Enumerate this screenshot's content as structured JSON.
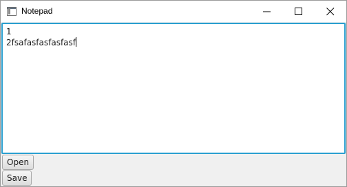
{
  "window": {
    "title": "Notepad",
    "icon": "notepad-app-icon"
  },
  "controls": {
    "minimize_icon": "minimize-icon",
    "maximize_icon": "maximize-icon",
    "close_icon": "close-icon"
  },
  "editor": {
    "lines": [
      "1",
      "2fsafasfasfasfasf"
    ]
  },
  "buttons": {
    "open_label": "Open",
    "save_label": "Save"
  },
  "colors": {
    "focus_border": "#2a9fd0"
  }
}
